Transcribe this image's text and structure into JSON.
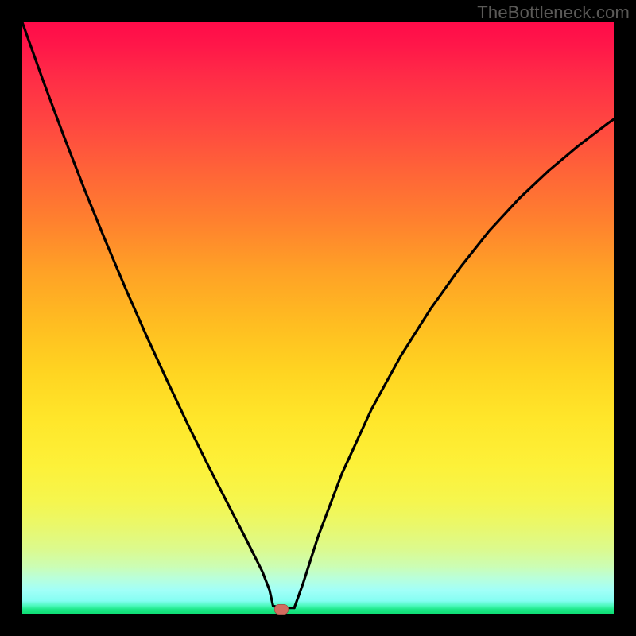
{
  "watermark": "TheBottleneck.com",
  "marker": {
    "x_frac": 0.438,
    "y_frac": 0.992,
    "color": "#d36b5f"
  },
  "chart_data": {
    "type": "line",
    "title": "",
    "xlabel": "",
    "ylabel": "",
    "xlim": [
      0,
      1
    ],
    "ylim": [
      0,
      1
    ],
    "background_gradient": [
      "red",
      "orange",
      "yellow",
      "green"
    ],
    "series": [
      {
        "name": "left-branch",
        "x": [
          0.0,
          0.035,
          0.07,
          0.105,
          0.14,
          0.175,
          0.21,
          0.245,
          0.28,
          0.315,
          0.35,
          0.378,
          0.406,
          0.418,
          0.422,
          0.424,
          0.44,
          0.46
        ],
        "y": [
          1.0,
          0.902,
          0.808,
          0.718,
          0.632,
          0.549,
          0.47,
          0.394,
          0.32,
          0.249,
          0.181,
          0.127,
          0.071,
          0.04,
          0.022,
          0.013,
          0.01,
          0.01
        ]
      },
      {
        "name": "right-branch",
        "x": [
          0.46,
          0.475,
          0.5,
          0.54,
          0.59,
          0.64,
          0.69,
          0.74,
          0.79,
          0.84,
          0.89,
          0.94,
          0.99,
          1.0
        ],
        "y": [
          0.01,
          0.052,
          0.13,
          0.236,
          0.345,
          0.436,
          0.515,
          0.585,
          0.648,
          0.702,
          0.749,
          0.791,
          0.829,
          0.836
        ]
      }
    ],
    "marker_points": [
      {
        "x": 0.438,
        "y": 0.008,
        "color": "#d36b5f"
      }
    ]
  }
}
